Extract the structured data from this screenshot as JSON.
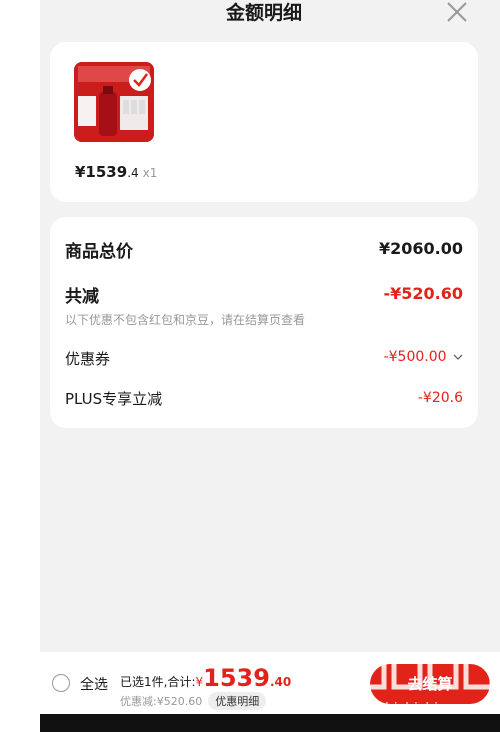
{
  "header": {
    "title": "金额明细"
  },
  "product": {
    "price_main": "¥1539",
    "price_dec": ".4",
    "qty": "x1",
    "image_icon": "skin-care-product-photo"
  },
  "summary": {
    "total_label": "商品总价",
    "total_value": "¥2060.00",
    "discount_label": "共减",
    "discount_value": "-¥520.60",
    "note": "以下优惠不包含红包和京豆，请在结算页查看",
    "coupon_label": "优惠券",
    "coupon_value": "-¥500.00",
    "plus_label": "PLUS专享立减",
    "plus_value": "-¥20.6"
  },
  "bottom": {
    "select_all": "全选",
    "selected_text": "已选1件,合计:",
    "currency": "¥",
    "total_big": "1539",
    "total_cents": ".40",
    "saved": "优惠减:¥520.60",
    "detail_btn": "优惠明细",
    "checkout": "去结算"
  },
  "colors": {
    "accent": "#e2231a",
    "bg": "#f2f2f2"
  }
}
